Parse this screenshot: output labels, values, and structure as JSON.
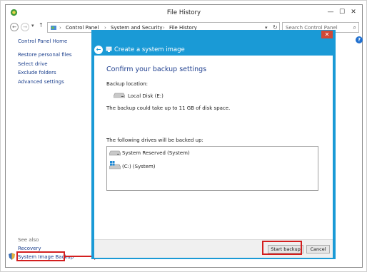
{
  "window": {
    "title": "File History",
    "controls": {
      "minimize": "—",
      "maximize": "☐",
      "close": "✕"
    }
  },
  "address": {
    "back": "←",
    "forward": "→",
    "dropdown": "▾",
    "up": "↑",
    "separator": "›",
    "breadcrumbs": [
      "Control Panel",
      "System and Security",
      "File History"
    ],
    "search_placeholder": "Search Control Panel",
    "help": "?"
  },
  "sidebar": {
    "home": "Control Panel Home",
    "links": [
      "Restore personal files",
      "Select drive",
      "Exclude folders",
      "Advanced settings"
    ],
    "see_also": "See also",
    "see_also_links": [
      "Recovery",
      "System Image Backup"
    ]
  },
  "dialog": {
    "close": "✕",
    "title": "Create a system image",
    "heading": "Confirm your backup settings",
    "backup_location_label": "Backup location:",
    "backup_location_value": "Local Disk (E:)",
    "size_note": "The backup could take up to 11 GB of disk space.",
    "drives_label": "The following drives will be backed up:",
    "drives": [
      "System Reserved (System)",
      "(C:) (System)"
    ],
    "start_button": "Start backup",
    "cancel_button": "Cancel"
  },
  "colors": {
    "dialog_accent": "#1a9ad6",
    "highlight": "#d31f1f",
    "link": "#1a3e8c"
  }
}
